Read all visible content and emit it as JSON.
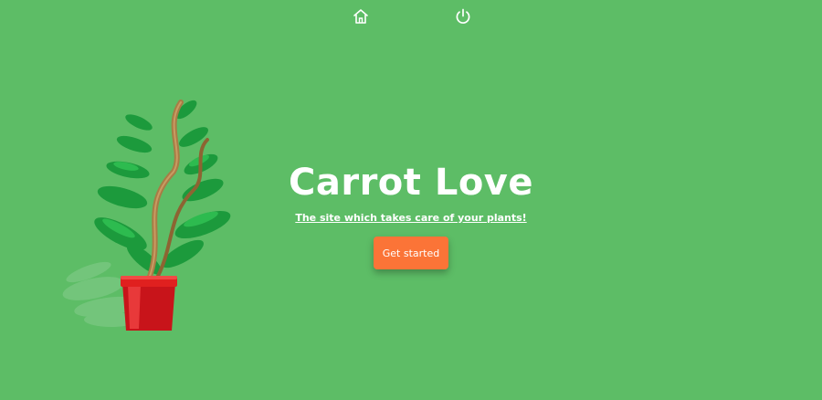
{
  "nav": {
    "home_icon": "home-icon",
    "power_icon": "power-icon"
  },
  "hero": {
    "title": "Carrot Love",
    "subtitle": "The site which takes care of your plants!",
    "cta_label": "Get started"
  },
  "colors": {
    "background": "#5dbd66",
    "accent": "#fb7437",
    "text": "#ffffff",
    "pot": "#d9191c"
  }
}
